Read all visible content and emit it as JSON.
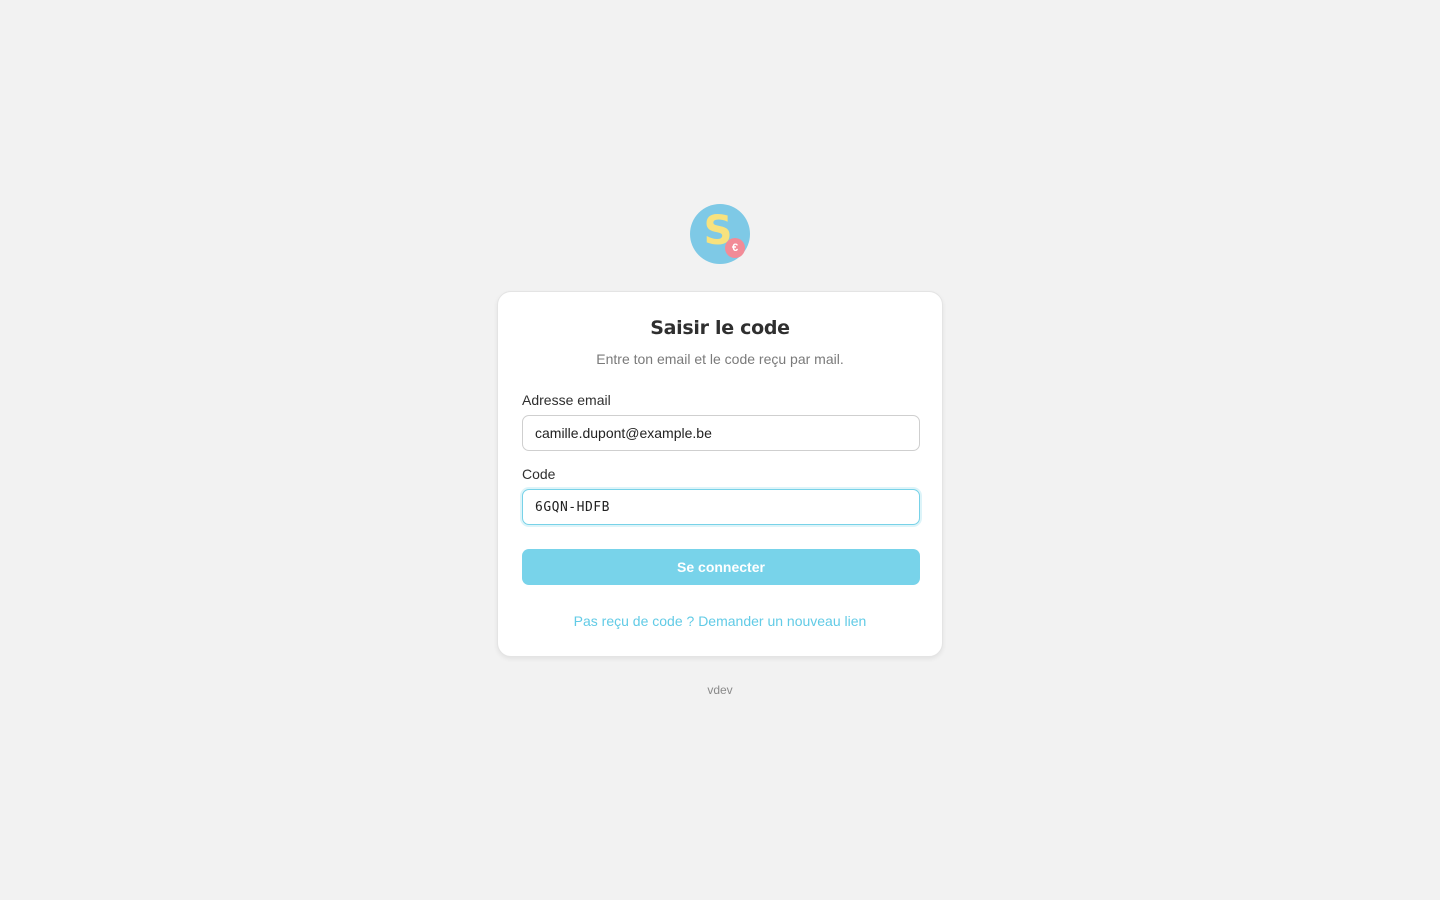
{
  "logo": {
    "letter": "S",
    "badge": "€",
    "colors": {
      "circle": "#7ec9e6",
      "letter": "#f7e27e",
      "badge": "#f28b97"
    }
  },
  "form": {
    "title": "Saisir le code",
    "subtitle": "Entre ton email et le code reçu par mail.",
    "email": {
      "label": "Adresse email",
      "value": "camille.dupont@example.be"
    },
    "code": {
      "label": "Code",
      "value": "6GQN-HDFB"
    },
    "submit_label": "Se connecter",
    "resend_link": "Pas reçu de code ? Demander un nouveau lien"
  },
  "footer": {
    "version": "vdev"
  },
  "colors": {
    "background": "#f2f2f2",
    "accent": "#78d3ea",
    "link": "#62cbe6"
  }
}
